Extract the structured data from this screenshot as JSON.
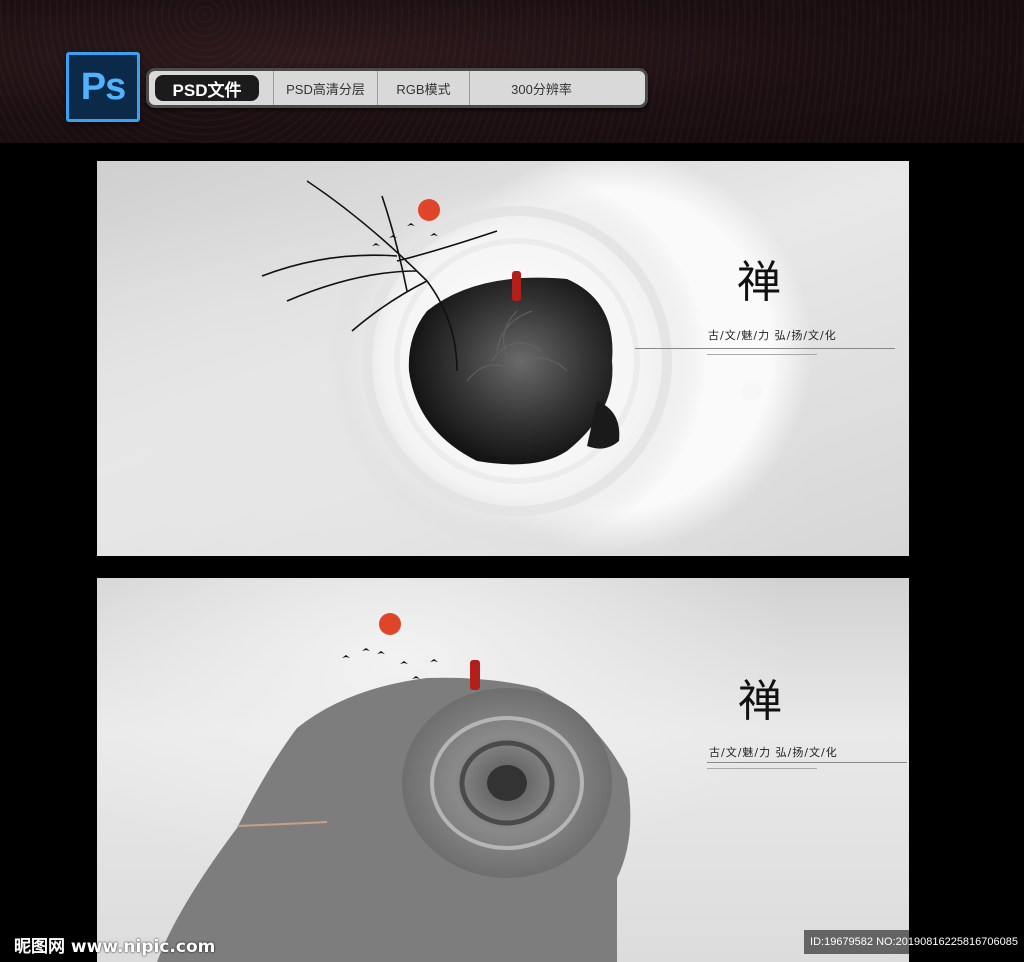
{
  "header": {
    "logo_text": "Ps",
    "badge": "PSD文件",
    "items": [
      "PSD高清分层",
      "RGB模式",
      "300分辨率"
    ]
  },
  "panel_top": {
    "glyph": "禅",
    "slogan": "古/文/魅/力  弘/扬/文/化"
  },
  "panel_bottom": {
    "glyph": "禅",
    "slogan": "古/文/魅/力   弘/扬/文/化"
  },
  "watermark": {
    "site": "昵图网 www.nipic.com",
    "id_line": "ID:19679582 NO:20190816225816706085"
  },
  "colors": {
    "sun": "#e0452a",
    "figure": "#b3201c",
    "ps_blue": "#4fb3ff"
  }
}
